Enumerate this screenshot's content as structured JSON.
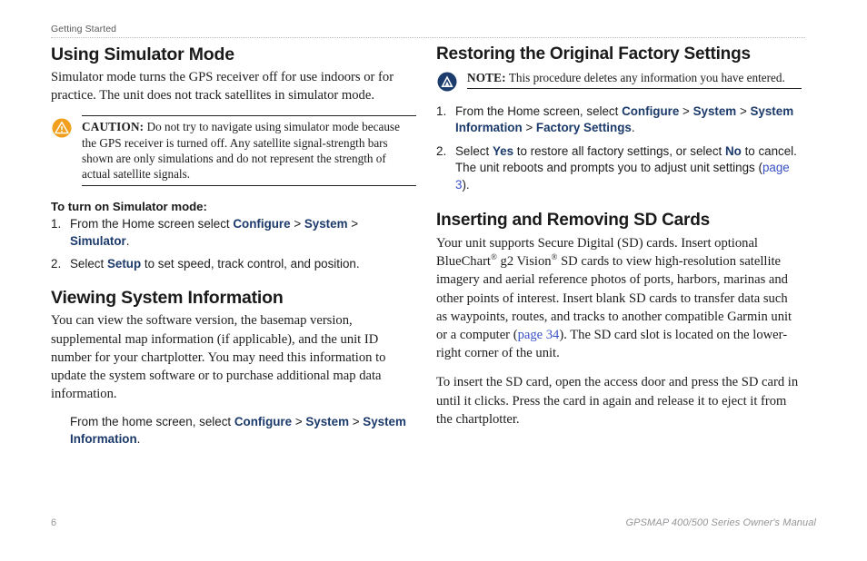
{
  "header": {
    "running_head": "Getting Started"
  },
  "left_column": {
    "section1": {
      "title": "Using Simulator Mode",
      "intro": "Simulator mode turns the GPS receiver off for use indoors or for practice. The unit does not track satellites in simulator mode.",
      "caution": {
        "icon": "caution-triangle-icon",
        "keyword": "CAUTION:",
        "text": " Do not try to navigate using simulator mode because the GPS receiver is turned off. Any satellite signal-strength bars shown are only simulations and do not represent the strength of actual satellite signals."
      },
      "subhead": "To turn on Simulator mode:",
      "steps": [
        {
          "num": "1.",
          "parts": [
            {
              "type": "text",
              "text": "From the Home screen select "
            },
            {
              "type": "ui",
              "text": "Configure"
            },
            {
              "type": "text",
              "text": " > "
            },
            {
              "type": "ui",
              "text": "System"
            },
            {
              "type": "text",
              "text": " > "
            },
            {
              "type": "ui",
              "text": "Simulator"
            },
            {
              "type": "text",
              "text": "."
            }
          ]
        },
        {
          "num": "2.",
          "parts": [
            {
              "type": "text",
              "text": "Select "
            },
            {
              "type": "ui",
              "text": "Setup"
            },
            {
              "type": "text",
              "text": " to set speed, track control, and position."
            }
          ]
        }
      ]
    },
    "section2": {
      "title": "Viewing System Information",
      "intro": "You can view the software version, the basemap version, supplemental map information (if applicable), and the unit ID number for your chartplotter. You may need this information to update the system software or to purchase additional map data information.",
      "instruction_parts": [
        {
          "type": "text",
          "text": "From the home screen, select "
        },
        {
          "type": "ui",
          "text": "Configure"
        },
        {
          "type": "text",
          "text": " > "
        },
        {
          "type": "ui",
          "text": "System"
        },
        {
          "type": "text",
          "text": " > "
        },
        {
          "type": "ui",
          "text": "System Information"
        },
        {
          "type": "text",
          "text": "."
        }
      ]
    }
  },
  "right_column": {
    "section1": {
      "title": "Restoring the Original Factory Settings",
      "note": {
        "icon": "garmin-note-icon",
        "keyword": "NOTE:",
        "text": " This procedure deletes any information you have entered."
      },
      "steps": [
        {
          "num": "1.",
          "parts": [
            {
              "type": "text",
              "text": "From the Home screen, select "
            },
            {
              "type": "ui",
              "text": "Configure"
            },
            {
              "type": "text",
              "text": " > "
            },
            {
              "type": "ui",
              "text": "System"
            },
            {
              "type": "text",
              "text": " > "
            },
            {
              "type": "ui",
              "text": "System Information"
            },
            {
              "type": "text",
              "text": " > "
            },
            {
              "type": "ui",
              "text": "Factory Settings"
            },
            {
              "type": "text",
              "text": "."
            }
          ]
        },
        {
          "num": "2.",
          "parts": [
            {
              "type": "text",
              "text": "Select "
            },
            {
              "type": "ui",
              "text": "Yes"
            },
            {
              "type": "text",
              "text": " to restore all factory settings, or select "
            },
            {
              "type": "ui",
              "text": "No"
            },
            {
              "type": "text",
              "text": " to cancel. The unit reboots and prompts you to adjust unit settings ("
            },
            {
              "type": "link",
              "text": "page 3"
            },
            {
              "type": "text",
              "text": ")."
            }
          ]
        }
      ]
    },
    "section2": {
      "title": "Inserting and Removing SD Cards",
      "para1_parts": [
        {
          "type": "text",
          "text": "Your unit supports Secure Digital (SD) cards. Insert optional BlueChart"
        },
        {
          "type": "reg",
          "text": "®"
        },
        {
          "type": "text",
          "text": " g2 Vision"
        },
        {
          "type": "reg",
          "text": "®"
        },
        {
          "type": "text",
          "text": " SD cards to view high-resolution satellite imagery and aerial reference photos of ports, harbors, marinas and other points of interest. Insert blank SD cards to transfer data such as waypoints, routes, and tracks to another compatible Garmin unit or a computer ("
        },
        {
          "type": "link",
          "text": "page 34"
        },
        {
          "type": "text",
          "text": "). The SD card slot is located on the lower-right corner of the unit."
        }
      ],
      "para2": "To insert the SD card, open the access door and press the SD card in until it clicks. Press the card in again and release it to eject it from the chartplotter."
    }
  },
  "footer": {
    "page_number": "6",
    "manual_title": "GPSMAP 400/500 Series Owner's Manual"
  },
  "colors": {
    "ui_term": "#1b3a6b",
    "page_link": "#3a52c6",
    "caution_icon": "#f0a01e",
    "note_icon": "#1c3c6e",
    "header_text": "#58595b",
    "footer_text": "#939598"
  }
}
